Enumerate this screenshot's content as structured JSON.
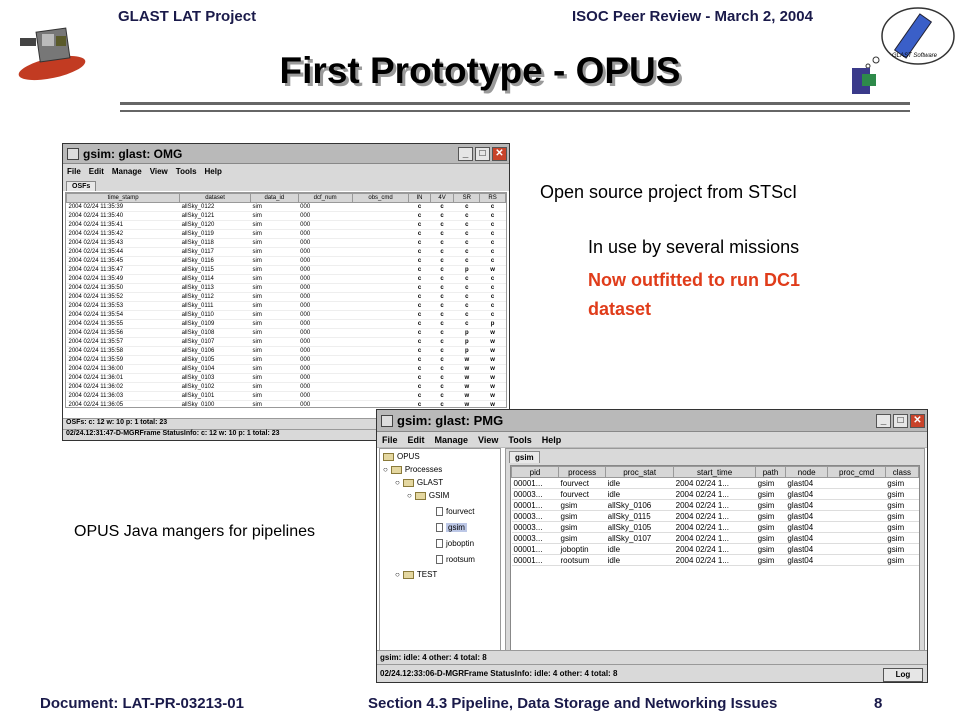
{
  "header": {
    "left": "GLAST LAT Project",
    "right": "ISOC Peer Review -  March 2, 2004"
  },
  "title": "First Prototype - OPUS",
  "footer": {
    "left": "Document:  LAT-PR-03213-01",
    "right": "Section 4.3  Pipeline, Data Storage and Networking Issues",
    "page": "8"
  },
  "logo_right_text": "GLAST Software",
  "bullets": {
    "line1": "Open source project from STScI",
    "line2": "In use by several missions",
    "line3a": "Now outfitted to run DC1",
    "line3b": "dataset",
    "caption": "OPUS Java mangers for pipelines"
  },
  "colors": {
    "accent_red": "#e03c1a",
    "header_text": "#1a1a4a"
  },
  "omg": {
    "title": "gsim: glast: OMG",
    "menu": [
      "File",
      "Edit",
      "Manage",
      "View",
      "Tools",
      "Help"
    ],
    "tab": "OSFs",
    "columns": [
      "time_stamp",
      "dataset",
      "data_id",
      "dcf_num",
      "obs_cmd",
      "IN",
      "4V",
      "SR",
      "RS"
    ],
    "rows": [
      [
        "2004 02/24 11:35:39",
        "allSky_0122",
        "sim",
        "000",
        "",
        "c",
        "c",
        "c",
        "c"
      ],
      [
        "2004 02/24 11:35:40",
        "allSky_0121",
        "sim",
        "000",
        "",
        "c",
        "c",
        "c",
        "c"
      ],
      [
        "2004 02/24 11:35:41",
        "allSky_0120",
        "sim",
        "000",
        "",
        "c",
        "c",
        "c",
        "c"
      ],
      [
        "2004 02/24 11:35:42",
        "allSky_0119",
        "sim",
        "000",
        "",
        "c",
        "c",
        "c",
        "c"
      ],
      [
        "2004 02/24 11:35:43",
        "allSky_0118",
        "sim",
        "000",
        "",
        "c",
        "c",
        "c",
        "c"
      ],
      [
        "2004 02/24 11:35:44",
        "allSky_0117",
        "sim",
        "000",
        "",
        "c",
        "c",
        "c",
        "c"
      ],
      [
        "2004 02/24 11:35:45",
        "allSky_0116",
        "sim",
        "000",
        "",
        "c",
        "c",
        "c",
        "c"
      ],
      [
        "2004 02/24 11:35:47",
        "allSky_0115",
        "sim",
        "000",
        "",
        "c",
        "c",
        "p",
        "w"
      ],
      [
        "2004 02/24 11:35:49",
        "allSky_0114",
        "sim",
        "000",
        "",
        "c",
        "c",
        "c",
        "c"
      ],
      [
        "2004 02/24 11:35:50",
        "allSky_0113",
        "sim",
        "000",
        "",
        "c",
        "c",
        "c",
        "c"
      ],
      [
        "2004 02/24 11:35:52",
        "allSky_0112",
        "sim",
        "000",
        "",
        "c",
        "c",
        "c",
        "c"
      ],
      [
        "2004 02/24 11:35:53",
        "allSky_0111",
        "sim",
        "000",
        "",
        "c",
        "c",
        "c",
        "c"
      ],
      [
        "2004 02/24 11:35:54",
        "allSky_0110",
        "sim",
        "000",
        "",
        "c",
        "c",
        "c",
        "c"
      ],
      [
        "2004 02/24 11:35:55",
        "allSky_0109",
        "sim",
        "000",
        "",
        "c",
        "c",
        "c",
        "p"
      ],
      [
        "2004 02/24 11:35:56",
        "allSky_0108",
        "sim",
        "000",
        "",
        "c",
        "c",
        "p",
        "w"
      ],
      [
        "2004 02/24 11:35:57",
        "allSky_0107",
        "sim",
        "000",
        "",
        "c",
        "c",
        "p",
        "w"
      ],
      [
        "2004 02/24 11:35:58",
        "allSky_0106",
        "sim",
        "000",
        "",
        "c",
        "c",
        "p",
        "w"
      ],
      [
        "2004 02/24 11:35:59",
        "allSky_0105",
        "sim",
        "000",
        "",
        "c",
        "c",
        "w",
        "w"
      ],
      [
        "2004 02/24 11:36:00",
        "allSky_0104",
        "sim",
        "000",
        "",
        "c",
        "c",
        "w",
        "w"
      ],
      [
        "2004 02/24 11:36:01",
        "allSky_0103",
        "sim",
        "000",
        "",
        "c",
        "c",
        "w",
        "w"
      ],
      [
        "2004 02/24 11:36:02",
        "allSky_0102",
        "sim",
        "000",
        "",
        "c",
        "c",
        "w",
        "w"
      ],
      [
        "2004 02/24 11:36:03",
        "allSky_0101",
        "sim",
        "000",
        "",
        "c",
        "c",
        "w",
        "w"
      ],
      [
        "2004 02/24 11:36:05",
        "allSky_0100",
        "sim",
        "000",
        "",
        "c",
        "c",
        "w",
        "w"
      ]
    ],
    "status1": "OSFs: c: 12 w: 10 p: 1 total: 23",
    "status2": "02/24.12:31:47-D-MGRFrame StatusInfo: c: 12 w: 10 p: 1 total: 23"
  },
  "pmg": {
    "title": "gsim: glast: PMG",
    "menu": [
      "File",
      "Edit",
      "Manage",
      "View",
      "Tools",
      "Help"
    ],
    "tree": {
      "root": "OPUS",
      "processes": "Processes",
      "glast": "GLAST",
      "gsim_node": "GSIM",
      "leaves": [
        "fourvect",
        "gsim",
        "joboptin",
        "rootsum"
      ],
      "test": "TEST"
    },
    "tab": "gsim",
    "columns": [
      "pid",
      "process",
      "proc_stat",
      "start_time",
      "path",
      "node",
      "proc_cmd",
      "class"
    ],
    "rows": [
      [
        "00001...",
        "fourvect",
        "idle",
        "2004 02/24 1...",
        "gsim",
        "glast04",
        "",
        "gsim"
      ],
      [
        "00003...",
        "fourvect",
        "idle",
        "2004 02/24 1...",
        "gsim",
        "glast04",
        "",
        "gsim"
      ],
      [
        "00001...",
        "gsim",
        "allSky_0106",
        "2004 02/24 1...",
        "gsim",
        "glast04",
        "",
        "gsim"
      ],
      [
        "00003...",
        "gsim",
        "allSky_0115",
        "2004 02/24 1...",
        "gsim",
        "glast04",
        "",
        "gsim"
      ],
      [
        "00003...",
        "gsim",
        "allSky_0105",
        "2004 02/24 1...",
        "gsim",
        "glast04",
        "",
        "gsim"
      ],
      [
        "00003...",
        "gsim",
        "allSky_0107",
        "2004 02/24 1...",
        "gsim",
        "glast04",
        "",
        "gsim"
      ],
      [
        "00001...",
        "joboptin",
        "idle",
        "2004 02/24 1...",
        "gsim",
        "glast04",
        "",
        "gsim"
      ],
      [
        "00001...",
        "rootsum",
        "idle",
        "2004 02/24 1...",
        "gsim",
        "glast04",
        "",
        "gsim"
      ]
    ],
    "status1": "gsim: idle: 4 other: 4 total: 8",
    "status2": "02/24.12:33:06-D-MGRFrame StatusInfo: idle: 4 other: 4 total: 8",
    "log_label": "Log"
  }
}
